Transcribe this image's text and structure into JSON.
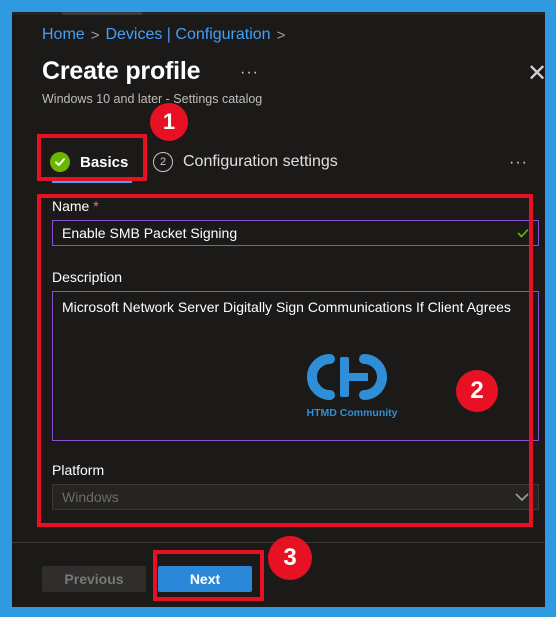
{
  "breadcrumb": {
    "home": "Home",
    "sep1": ">",
    "devices": "Devices | Configuration",
    "sep2": ">"
  },
  "header": {
    "title": "Create profile",
    "more": "···",
    "subtitle": "Windows 10 and later - Settings catalog",
    "close": "✕"
  },
  "steps": {
    "basics": {
      "label": "Basics",
      "status": "complete"
    },
    "config": {
      "number": "2",
      "label": "Configuration settings"
    },
    "more": "···"
  },
  "form": {
    "name_label": "Name",
    "required_mark": "*",
    "name_value": "Enable SMB Packet Signing",
    "description_label": "Description",
    "description_value": "Microsoft Network Server Digitally Sign Communications If Client Agrees",
    "platform_label": "Platform",
    "platform_value": "Windows"
  },
  "watermark": {
    "logo_letters": "CHD",
    "caption": "HTMD Community"
  },
  "footer": {
    "previous_label": "Previous",
    "next_label": "Next"
  },
  "annotations": {
    "marker1": "1",
    "marker2": "2",
    "marker3": "3",
    "highlight_color": "#e81123"
  },
  "colors": {
    "accent": "#479ef5",
    "success": "#6bb700",
    "input_focus": "#8a4fd1",
    "primary_button": "#2b88d8",
    "panel_bg": "#1b1a19"
  }
}
